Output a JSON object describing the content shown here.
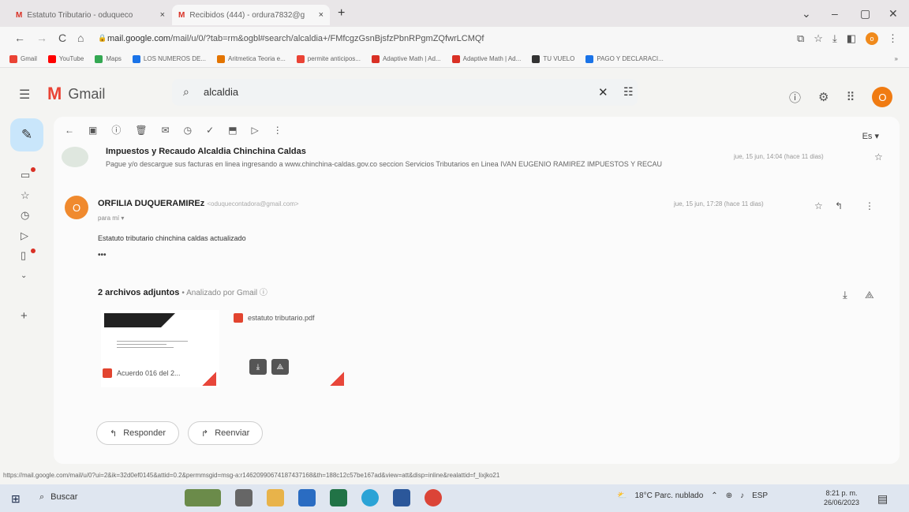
{
  "browser": {
    "tabs": [
      {
        "label": "Estatuto Tributario - oduqueco",
        "close": "×"
      },
      {
        "label": "Recibidos (444) - ordura7832@g",
        "close": "×"
      }
    ],
    "new_tab": "+",
    "window_controls": {
      "chevron": "⌄",
      "minimize": "–",
      "maximize": "▢",
      "close": "✕"
    },
    "nav": {
      "back": "←",
      "forward": "→",
      "reload": "C",
      "home": "⌂"
    },
    "url_host": "mail.google.com",
    "url_path": "/mail/u/0/?tab=rm&ogbl#search/alcaldia+/FMfcgzGsnBjsfzPbnRPgmZQfwrLCMQf",
    "profile_initial": "o",
    "bookmarks": [
      "Gmail",
      "YouTube",
      "Maps",
      "LOS NUMEROS DE...",
      "Aritmetica Teoria e...",
      "permite anticipos...",
      "Adaptive Math | Ad...",
      "Adaptive Math | Ad...",
      "TU VUELO",
      "PAGO Y DECLARACI..."
    ],
    "bookmark_colors": [
      "#ea4335",
      "#ff0000",
      "#34a853",
      "#1a73e8",
      "#e37400",
      "#ea4335",
      "#d93025",
      "#d93025",
      "#333333",
      "#1a73e8"
    ],
    "bookmark_more": "»"
  },
  "gmail": {
    "app_name": "Gmail",
    "search_query": "alcaldia",
    "clear": "✕",
    "profile_initial": "O",
    "lang": "Es ▾",
    "thread": [
      {
        "sender": "Impuestos y Recaudo Alcaldia Chinchina Caldas",
        "snippet": "Pague y/o descargue sus facturas en linea ingresando a www.chinchina-caldas.gov.co seccion Servicios Tributarios en Linea IVAN EUGENIO RAMIREZ IMPUESTOS Y RECAU",
        "date": "jue, 15 jun, 14:04 (hace 11 dias)"
      },
      {
        "sender": "ORFILIA DUQUERAMIREz",
        "email": "<oduquecontadora@gmail.com>",
        "to": "para mí ▾",
        "date": "jue, 15 jun, 17:28 (hace 11 dias)",
        "body": "Estatuto tributario chinchina caldas actualizado",
        "ellipsis": "•••"
      }
    ],
    "attachments": {
      "heading": "2 archivos adjuntos",
      "analyzed": "• Analizado por Gmail ⓘ",
      "files": [
        {
          "name": "Acuerdo 016 del 2..."
        },
        {
          "name": "estatuto tributario.pdf"
        }
      ]
    },
    "reply_label": "Responder",
    "forward_label": "Reenviar"
  },
  "status_url": "https://mail.google.com/mail/u/0?ui=2&ik=32d0ef0145&attid=0.2&permmsgid=msg-a:r14620990674187437168&th=188c12c57be167ad&view=att&disp=inline&realattid=f_lixjko21",
  "taskbar": {
    "search": "Buscar",
    "weather": "18°C Parc. nublado",
    "lang": "ESP",
    "time": "8:21 p. m.",
    "date": "26/06/2023"
  }
}
